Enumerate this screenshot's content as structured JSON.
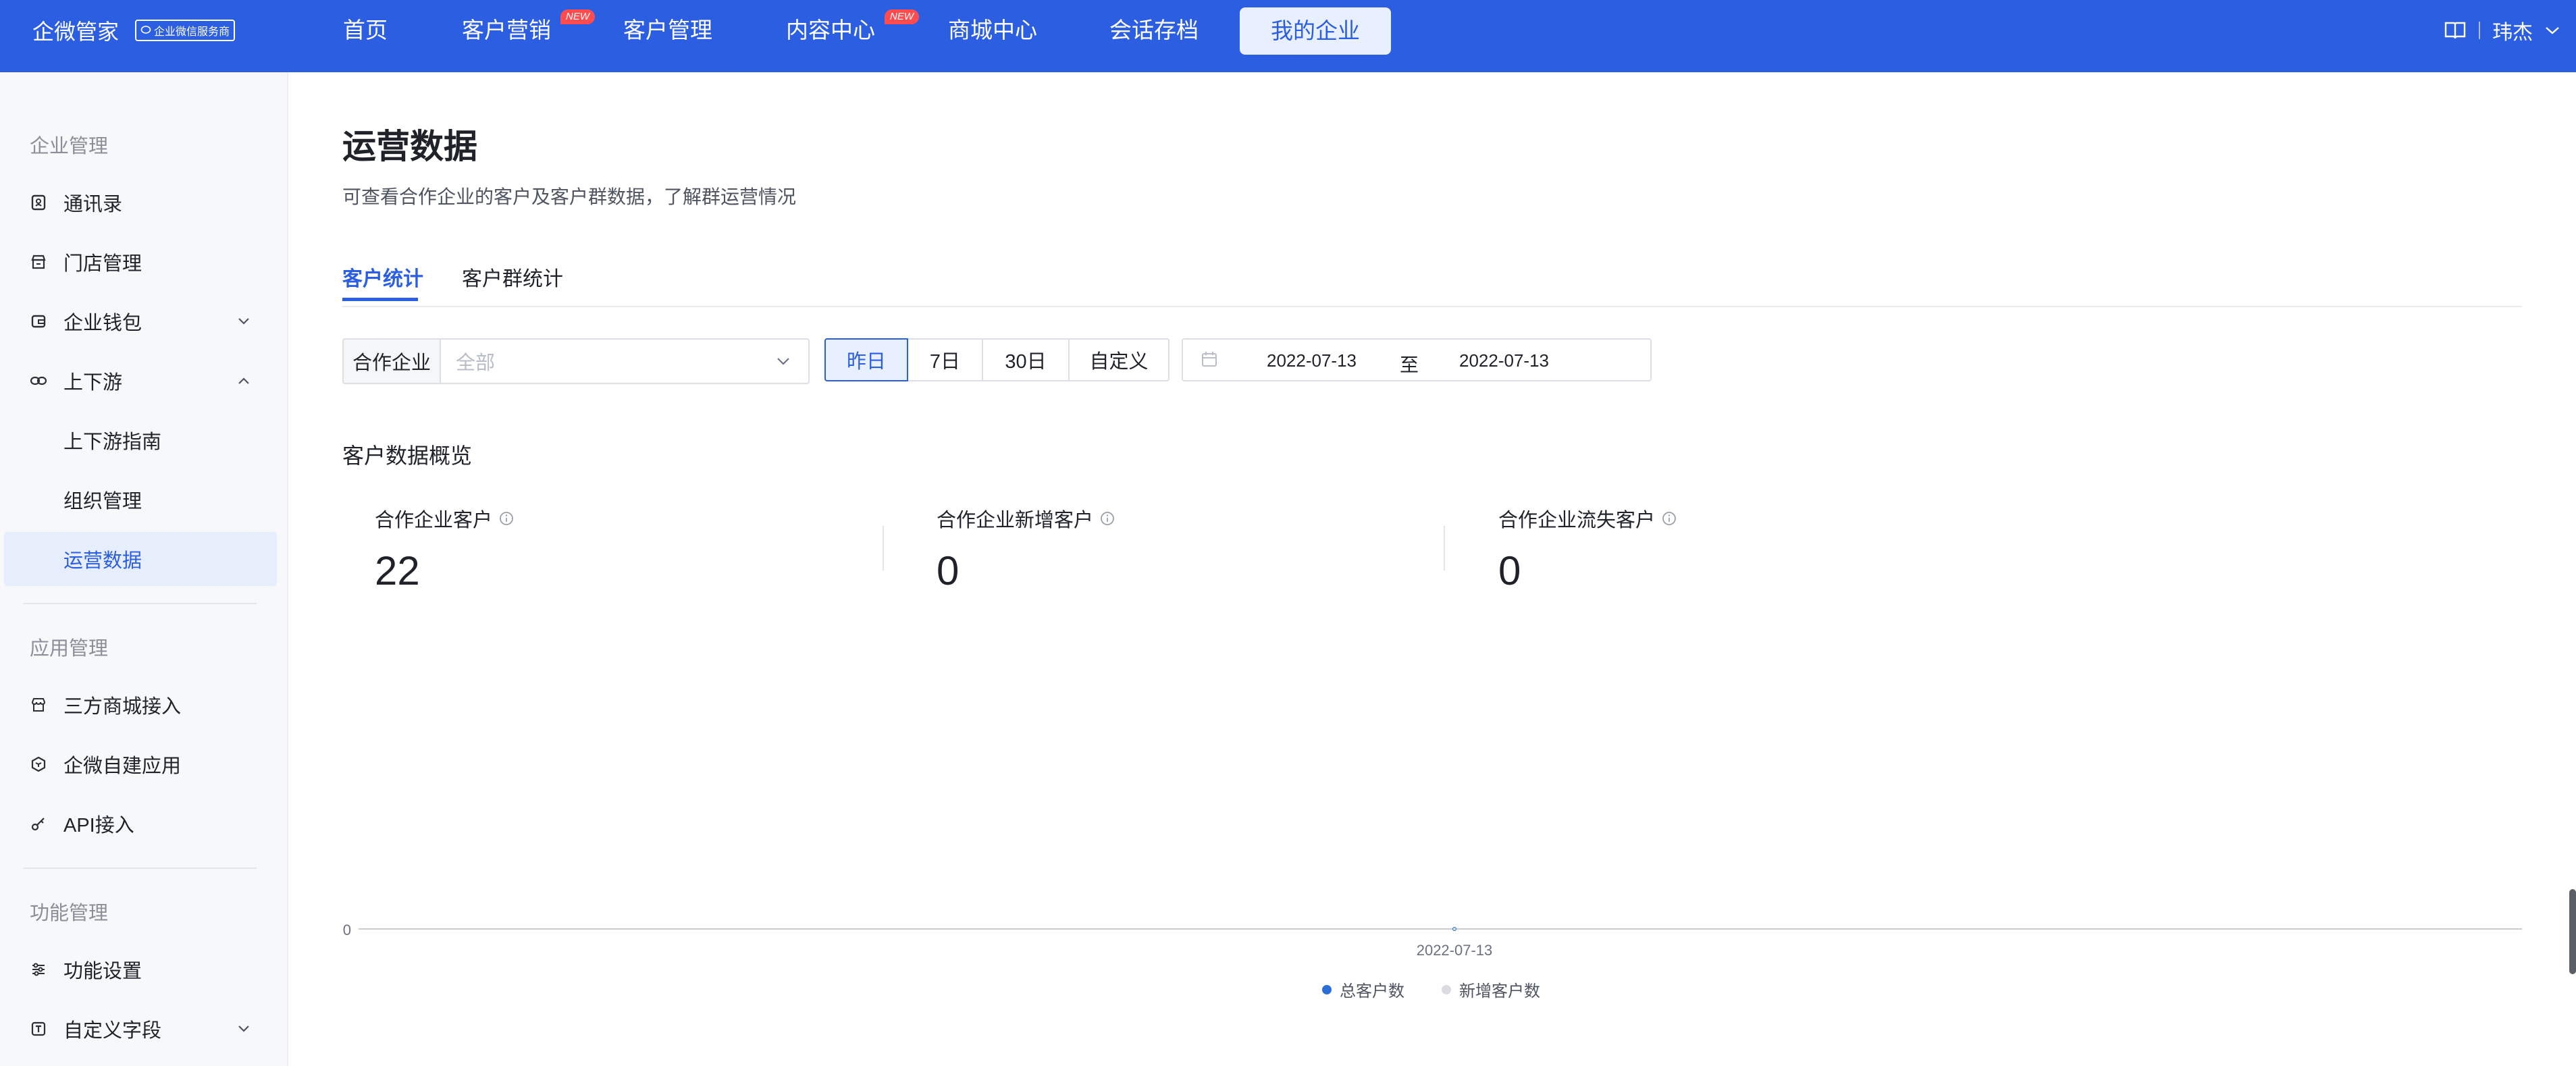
{
  "app": {
    "brand_name": "企微管家",
    "brand_badge": "企业微信服务商"
  },
  "nav": {
    "items": [
      {
        "label": "首页"
      },
      {
        "label": "客户营销",
        "badge": "NEW"
      },
      {
        "label": "客户管理"
      },
      {
        "label": "内容中心",
        "badge": "NEW"
      },
      {
        "label": "商城中心"
      },
      {
        "label": "会话存档"
      }
    ],
    "active_label": "我的企业",
    "user_name": "玮杰"
  },
  "sidebar": {
    "groups": [
      {
        "title": "企业管理"
      },
      {
        "title": "应用管理"
      },
      {
        "title": "功能管理"
      }
    ],
    "items": [
      {
        "label": "通讯录",
        "icon": "contacts-icon"
      },
      {
        "label": "门店管理",
        "icon": "store-icon"
      },
      {
        "label": "企业钱包",
        "icon": "wallet-icon"
      },
      {
        "label": "上下游",
        "icon": "link-icon"
      },
      {
        "label": "上下游指南"
      },
      {
        "label": "组织管理"
      },
      {
        "label": "运营数据"
      },
      {
        "label": "三方商城接入",
        "icon": "shop-icon"
      },
      {
        "label": "企微自建应用",
        "icon": "cube-icon"
      },
      {
        "label": "API接入",
        "icon": "api-icon"
      },
      {
        "label": "功能设置",
        "icon": "sliders-icon"
      },
      {
        "label": "自定义字段",
        "icon": "text-field-icon"
      }
    ]
  },
  "page": {
    "title": "运营数据",
    "description": "可查看合作企业的客户及客户群数据，了解群运营情况",
    "tabs": [
      {
        "label": "客户统计"
      },
      {
        "label": "客户群统计"
      }
    ],
    "filter": {
      "label": "合作企业",
      "placeholder": "全部"
    },
    "ranges": [
      {
        "label": "昨日"
      },
      {
        "label": "7日"
      },
      {
        "label": "30日"
      },
      {
        "label": "自定义"
      }
    ],
    "date_start": "2022-07-13",
    "date_sep": "至",
    "date_end": "2022-07-13",
    "section_title": "客户数据概览",
    "stats": [
      {
        "label": "合作企业客户",
        "value": "22"
      },
      {
        "label": "合作企业新增客户",
        "value": "0"
      },
      {
        "label": "合作企业流失客户",
        "value": "0"
      }
    ]
  },
  "chart_data": {
    "type": "line",
    "x": [
      "2022-07-13"
    ],
    "y_ticks": [
      "0"
    ],
    "series": [
      {
        "name": "总客户数",
        "values": [
          0
        ],
        "color": "#2b6fd6"
      },
      {
        "name": "新增客户数",
        "values": [
          0
        ],
        "color": "#d9dbe0"
      }
    ]
  }
}
